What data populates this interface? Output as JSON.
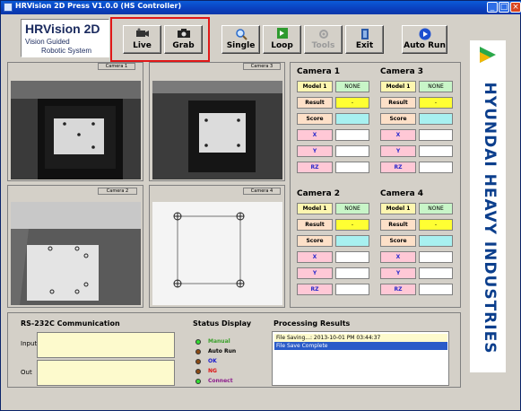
{
  "window": {
    "title": "HRVision 2D Press V1.0.0 (HS Controller)",
    "controls": {
      "minimize": "_",
      "maximize": "□",
      "close": "×"
    }
  },
  "logo": {
    "title": "HRVision 2D",
    "line1": "Vision Guided",
    "line2": "Robotic System"
  },
  "toolbar": {
    "live": {
      "label": "Live",
      "icon": "video-camera-icon"
    },
    "grab": {
      "label": "Grab",
      "icon": "camera-icon"
    },
    "single": {
      "label": "Single",
      "icon": "magnifier-icon"
    },
    "loop": {
      "label": "Loop",
      "icon": "arrow-right-icon"
    },
    "tools": {
      "label": "Tools",
      "icon": "tools-icon"
    },
    "exit": {
      "label": "Exit",
      "icon": "exit-door-icon"
    },
    "auto_run": {
      "label": "Auto Run",
      "icon": "play-icon"
    }
  },
  "cameras": {
    "cam1": {
      "label": "Camera 1"
    },
    "cam2": {
      "label": "Camera 2"
    },
    "cam3": {
      "label": "Camera 3"
    },
    "cam4": {
      "label": "Camera 4"
    }
  },
  "data_panel": {
    "cam1": {
      "title": "Camera 1",
      "model_label": "Model 1",
      "model_value": "NONE",
      "result_label": "Result",
      "result_value": "-",
      "score_label": "Score",
      "x_label": "X",
      "y_label": "Y",
      "rz_label": "RZ"
    },
    "cam2": {
      "title": "Camera 2",
      "model_label": "Model 1",
      "model_value": "NONE",
      "result_label": "Result",
      "result_value": "-",
      "score_label": "Score",
      "x_label": "X",
      "y_label": "Y",
      "rz_label": "RZ"
    },
    "cam3": {
      "title": "Camera 3",
      "model_label": "Model 1",
      "model_value": "NONE",
      "result_label": "Result",
      "result_value": "-",
      "score_label": "Score",
      "x_label": "X",
      "y_label": "Y",
      "rz_label": "RZ"
    },
    "cam4": {
      "title": "Camera 4",
      "model_label": "Model 1",
      "model_value": "NONE",
      "result_label": "Result",
      "result_value": "-",
      "score_label": "Score",
      "x_label": "X",
      "y_label": "Y",
      "rz_label": "RZ"
    }
  },
  "brand": {
    "text": "HYUNDAI HEAVY INDUSTRIES",
    "color": "#0b3e8c",
    "logo_colors": [
      "#2aa84a",
      "#f2b705"
    ]
  },
  "rs232": {
    "title": "RS-232C Communication",
    "input_label": "Input",
    "out_label": "Out"
  },
  "status": {
    "title": "Status Display",
    "items": [
      {
        "label": "Manual",
        "color": "#3aa02a",
        "led": "#33dd33"
      },
      {
        "label": "Auto Run",
        "color": "#000000",
        "led": "#8a4a14"
      },
      {
        "label": "OK",
        "color": "#1a1acc",
        "led": "#8a4a14"
      },
      {
        "label": "NG",
        "color": "#dd1111",
        "led": "#8a4a14"
      },
      {
        "label": "Connect",
        "color": "#8b1a8b",
        "led": "#33dd33"
      }
    ]
  },
  "processing": {
    "title": "Processing Results",
    "lines": [
      "File Saving...: 2013-10-01 PM 03:44:37",
      "File Save Complete"
    ]
  }
}
